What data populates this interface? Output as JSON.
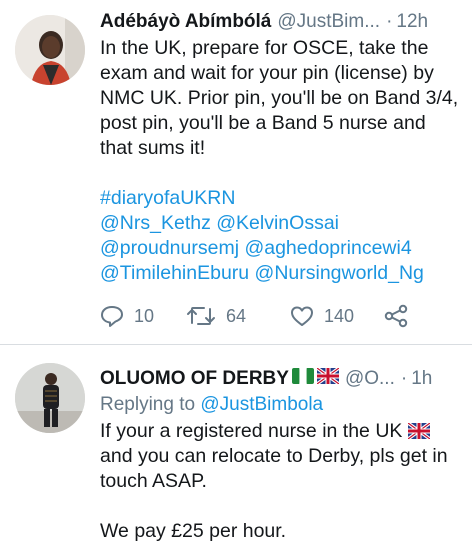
{
  "tweet1": {
    "author_name": "Adébáyò Abímbólá",
    "handle": "@JustBim...",
    "separator": "·",
    "time": "12h",
    "text_lines": [
      "In the UK, prepare for OSCE, take the",
      "exam and wait for your pin (license) by",
      "NMC UK. Prior pin, you'll be on Band 3/4,",
      "post pin, you'll be a Band 5 nurse and",
      "that sums it!"
    ],
    "hashtag": "#diaryofaUKRN",
    "mentions": {
      "line1": "@Nrs_Kethz @KelvinOssai",
      "line2": "@proudnursemj @aghedoprincewi4",
      "line3": "@TimilehinEburu @Nursingworld_Ng"
    },
    "actions": {
      "reply_count": "10",
      "retweet_count": "64",
      "like_count": "140"
    }
  },
  "tweet2": {
    "author_name": "OLUOMO OF DERBY",
    "handle": "@O...",
    "separator": "·",
    "time": "1h",
    "replying_to_label": "Replying to",
    "replying_to_handle": "@JustBimbola",
    "text_lines": [
      "If your a registered nurse in the UK",
      "and you can relocate to Derby, pls get in",
      "touch ASAP."
    ],
    "text_last": "We pay £25 per hour."
  },
  "colors": {
    "link": "#1b95e0",
    "secondary_text": "#657786",
    "divider": "#d9dde1"
  },
  "icons": [
    "reply-icon",
    "retweet-icon",
    "like-icon",
    "share-icon",
    "nigeria-flag-icon",
    "uk-flag-icon"
  ]
}
